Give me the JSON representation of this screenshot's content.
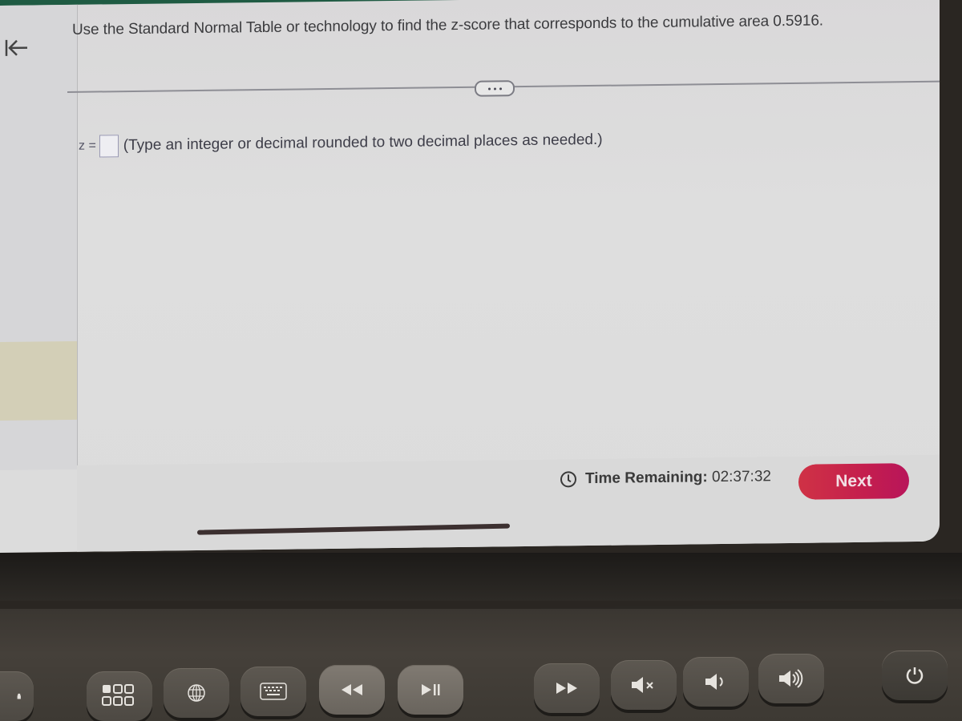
{
  "question": {
    "text": "Use the Standard Normal Table or technology to find the z-score that corresponds to the cumulative area 0.5916."
  },
  "answer": {
    "label": "z =",
    "value": "",
    "hint": "(Type an integer or decimal rounded to two decimal places as needed.)"
  },
  "more_button": {
    "label": "..."
  },
  "footer": {
    "timer_label": "Time Remaining:",
    "timer_value": "02:37:32",
    "next_label": "Next"
  },
  "colors": {
    "top_bar": "#1f5b43",
    "next_button": "#c41e4e",
    "rail_highlight": "#d3cfb7"
  },
  "keyboard": {
    "keys": [
      {
        "icon": "lock-icon"
      },
      {
        "icon": "app-switcher-icon"
      },
      {
        "icon": "globe-icon"
      },
      {
        "icon": "keyboard-icon"
      },
      {
        "icon": "rewind-icon"
      },
      {
        "icon": "play-pause-icon"
      },
      {
        "icon": "fast-forward-icon"
      },
      {
        "icon": "mute-icon"
      },
      {
        "icon": "volume-down-icon"
      },
      {
        "icon": "volume-up-icon"
      },
      {
        "icon": "power-icon"
      }
    ]
  }
}
